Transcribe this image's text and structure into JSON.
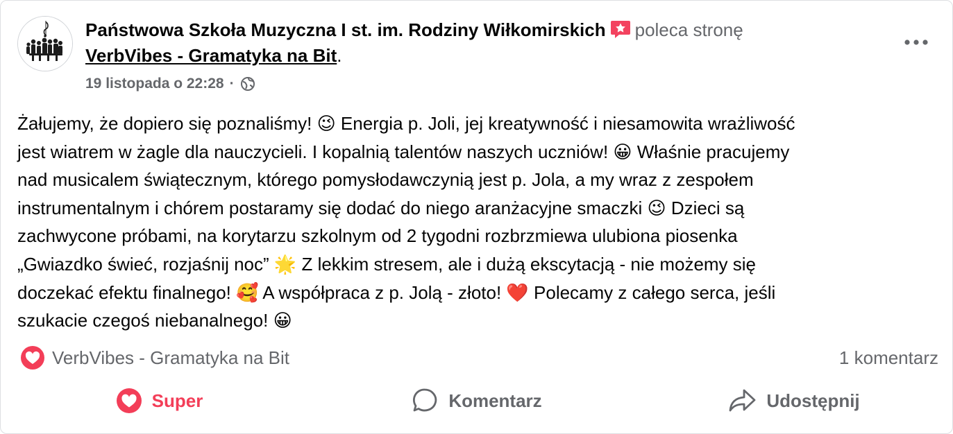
{
  "post": {
    "author": "Państwowa Szkoła Muzyczna I st. im. Rodziny Wiłkomirskich",
    "action_text": "poleca stronę",
    "page_name": "VerbVibes - Gramatyka na Bit",
    "page_suffix": ".",
    "timestamp": "19 listopada o 22:28",
    "separator": "·",
    "privacy_icon": "globe-icon",
    "body": "Żałujemy, że dopiero się poznaliśmy! 😉 Energia p. Joli, jej kreatywność i niesamowita wrażliwość\njest wiatrem w żagle dla nauczycieli. I kopalnią talentów naszych uczniów! 😀 Właśnie pracujemy\nnad musicalem świątecznym, którego pomysłodawczynią jest p. Jola, a my wraz z zespołem\ninstrumentalnym i chórem postaramy się dodać do niego aranżacyjne smaczki 😉 Dzieci są\nzachwycone próbami, na korytarzu szkolnym od 2 tygodni rozbrzmiewa ulubiona piosenka\n„Gwiazdko świeć, rozjaśnij noc” 🌟 Z lekkim stresem, ale i dużą ekscytacją - nie możemy się\ndoczekać efektu finalnego! 🥰 A współpraca z p. Jolą - złoto! ❤️ Polecamy z całego serca, jeśli\nszukacie czegoś niebanalnego! 😀"
  },
  "stats": {
    "reaction_name": "VerbVibes - Gramatyka na Bit",
    "comments": "1 komentarz"
  },
  "actions": {
    "like_label": "Super",
    "comment_label": "Komentarz",
    "share_label": "Udostępnij"
  },
  "colors": {
    "accent_red": "#f33e58",
    "secondary_text": "#65676b",
    "primary_text": "#050505"
  }
}
